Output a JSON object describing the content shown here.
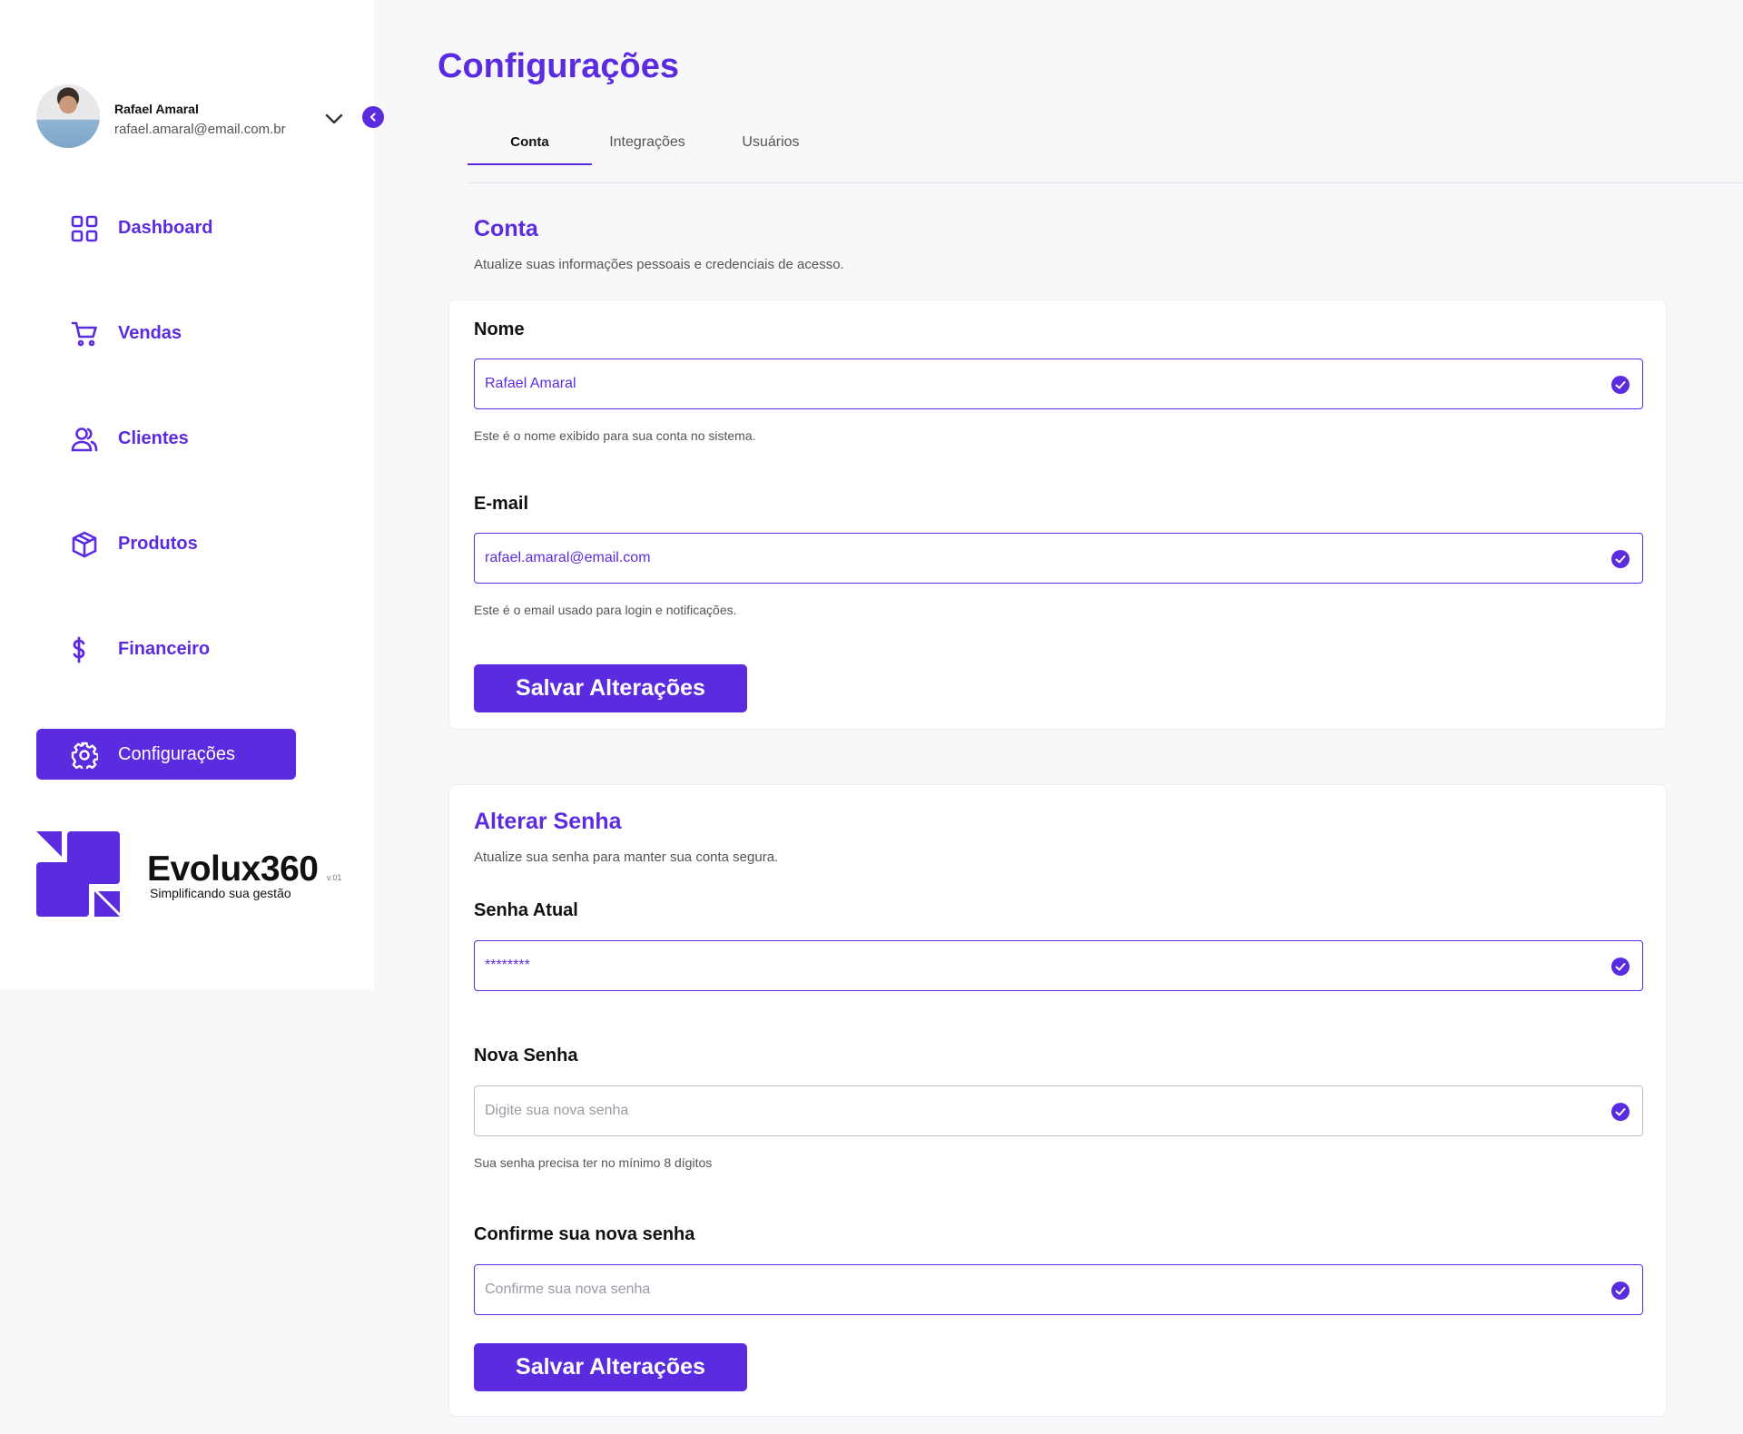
{
  "user": {
    "name": "Rafael Amaral",
    "email": "rafael.amaral@email.com.br"
  },
  "sidebar": {
    "items": [
      {
        "label": "Dashboard",
        "icon": "grid-icon"
      },
      {
        "label": "Vendas",
        "icon": "cart-icon"
      },
      {
        "label": "Clientes",
        "icon": "users-icon"
      },
      {
        "label": "Produtos",
        "icon": "box-icon"
      },
      {
        "label": "Financeiro",
        "icon": "dollar-icon"
      },
      {
        "label": "Configurações",
        "icon": "gear-icon",
        "active": true
      }
    ]
  },
  "brand": {
    "name": "Evolux360",
    "version": "v.01",
    "tagline": "Simplificando sua gestão"
  },
  "page": {
    "title": "Configurações",
    "tabs": [
      {
        "label": "Conta",
        "active": true
      },
      {
        "label": "Integrações"
      },
      {
        "label": "Usuários"
      }
    ]
  },
  "account": {
    "title": "Conta",
    "description": "Atualize suas informações pessoais e credenciais de acesso.",
    "name_label": "Nome",
    "name_value": "Rafael Amaral",
    "name_hint": "Este é o nome exibido para sua conta no sistema.",
    "email_label": "E-mail",
    "email_value": "rafael.amaral@email.com",
    "email_hint": "Este é o email usado para login e notificações.",
    "save_label": "Salvar Alterações"
  },
  "password": {
    "title": "Alterar Senha",
    "description": "Atualize sua senha para manter sua conta segura.",
    "current_label": "Senha Atual",
    "current_value": "********",
    "new_label": "Nova Senha",
    "new_placeholder": "Digite sua nova senha",
    "new_hint": "Sua senha precisa ter no mínimo 8 dígitos",
    "confirm_label": "Confirme sua nova senha",
    "confirm_placeholder": "Confirme sua nova senha",
    "save_label": "Salvar Alterações"
  },
  "colors": {
    "accent": "#5b2be0",
    "background": "#f8f8fa",
    "surface": "#ffffff"
  }
}
